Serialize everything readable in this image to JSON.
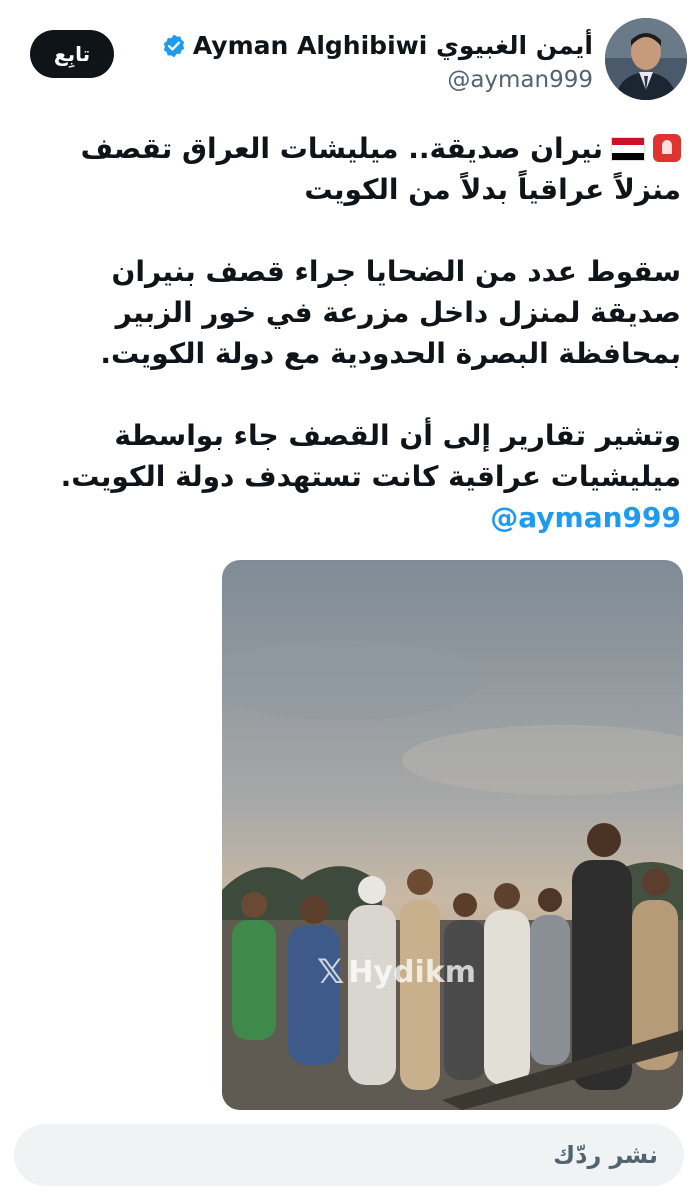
{
  "author": {
    "display_name": "أيمن الغبيوي Ayman Alghibiwi",
    "handle": "@ayman999",
    "verified_icon": "verified-badge-icon",
    "avatar_icon": "profile-photo"
  },
  "follow_button": {
    "label": "تابِع"
  },
  "tweet": {
    "paragraph1": "نيران صديقة.. ميليشات العراق تقصف منزلاً عراقياً بدلاً من الكويت",
    "paragraph2": "سقوط عدد من الضحايا جراء قصف بنيران صديقة لمنزل داخل مزرعة في خور الزبير بمحافظة البصرة الحدودية مع دولة الكويت.",
    "paragraph3": "وتشير تقارير إلى أن القصف جاء بواسطة ميليشيات عراقية كانت تستهدف دولة الكويت.",
    "mention": "@ayman999",
    "emojis": [
      "rotating-light-icon",
      "iraq-flag-icon"
    ]
  },
  "media": {
    "watermark": "Hydikm",
    "type": "video-still",
    "description_icon": "crowd-video-thumbnail"
  },
  "reply": {
    "placeholder": "نشر ردّك"
  },
  "colors": {
    "accent": "#1d9bf0",
    "text": "#0f1419",
    "secondary_text": "#536471",
    "reply_bg": "#eff3f4",
    "alert_red": "#e0322f"
  }
}
